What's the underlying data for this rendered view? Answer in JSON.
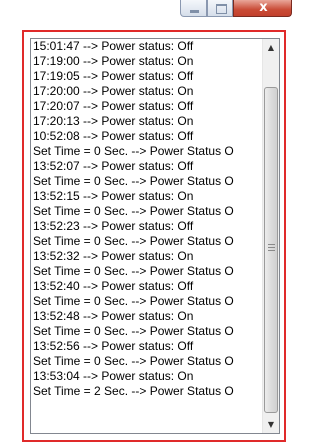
{
  "window": {
    "controls": {
      "minimize_icon": "minimize-icon",
      "maximize_icon": "maximize-icon",
      "close_label": "x"
    },
    "accent_colors": {
      "highlight_frame": "#e02a2a",
      "close_button": "#c94b36"
    }
  },
  "log_list": {
    "lines": [
      "15:01:47 --> Power status: Off",
      "17:19:00 --> Power status: On",
      "17:19:05 --> Power status: Off",
      "17:20:00 --> Power status: On",
      "17:20:07 --> Power status: Off",
      "17:20:13 --> Power status: On",
      "10:52:08 --> Power status: Off",
      "Set Time = 0 Sec. --> Power Status O",
      "13:52:07 --> Power status: Off",
      "Set Time = 0 Sec. --> Power Status O",
      "13:52:15 --> Power status: On",
      "Set Time = 0 Sec. --> Power Status O",
      "13:52:23 --> Power status: Off",
      "Set Time = 0 Sec. --> Power Status O",
      "13:52:32 --> Power status: On",
      "Set Time = 0 Sec. --> Power Status O",
      "13:52:40 --> Power status: Off",
      "Set Time = 0 Sec. --> Power Status O",
      "13:52:48 --> Power status: On",
      "Set Time = 0 Sec. --> Power Status O",
      "13:52:56 --> Power status: Off",
      "Set Time = 0 Sec. --> Power Status O",
      "13:53:04 --> Power status: On",
      "Set Time = 2 Sec. --> Power Status O"
    ]
  },
  "scrollbar": {
    "up_arrow": "▲",
    "down_arrow": "▼"
  }
}
